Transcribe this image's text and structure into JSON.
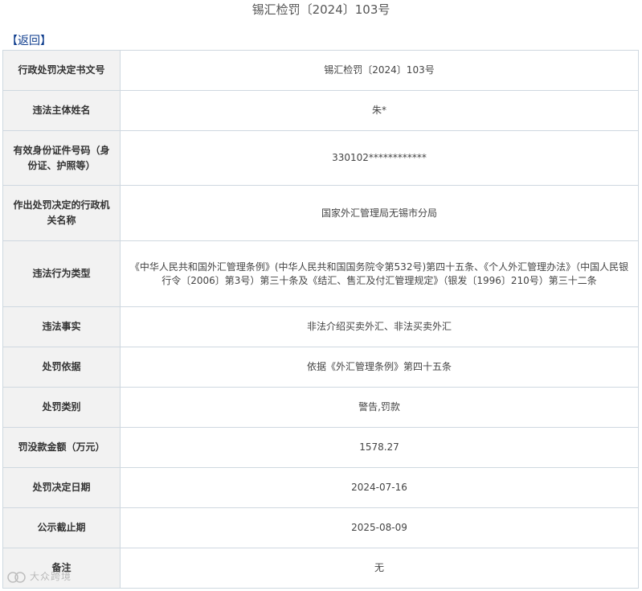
{
  "header": {
    "title": "锡汇检罚〔2024〕103号"
  },
  "nav": {
    "back_label": "【返回】"
  },
  "rows": [
    {
      "label": "行政处罚决定书文号",
      "value": "锡汇检罚〔2024〕103号"
    },
    {
      "label": "违法主体姓名",
      "value": "朱*"
    },
    {
      "label": "有效身份证件号码（身份证、护照等）",
      "value": "330102************"
    },
    {
      "label": "作出处罚决定的行政机关名称",
      "value": "国家外汇管理局无锡市分局"
    },
    {
      "label": "违法行为类型",
      "value": "《中华人民共和国外汇管理条例》(中华人民共和国国务院令第532号)第四十五条、《个人外汇管理办法》（中国人民银行令〔2006〕第3号）第三十条及《结汇、售汇及付汇管理规定》（银发〔1996〕210号）第三十二条"
    },
    {
      "label": "违法事实",
      "value": "非法介绍买卖外汇、非法买卖外汇"
    },
    {
      "label": "处罚依据",
      "value": "依据《外汇管理条例》第四十五条"
    },
    {
      "label": "处罚类别",
      "value": "警告,罚款"
    },
    {
      "label": "罚没款金额（万元）",
      "value": "1578.27"
    },
    {
      "label": "处罚决定日期",
      "value": "2024-07-16"
    },
    {
      "label": "公示截止期",
      "value": "2025-08-09"
    },
    {
      "label": "备注",
      "value": "无"
    }
  ],
  "watermark": {
    "text": "大众跨境"
  }
}
